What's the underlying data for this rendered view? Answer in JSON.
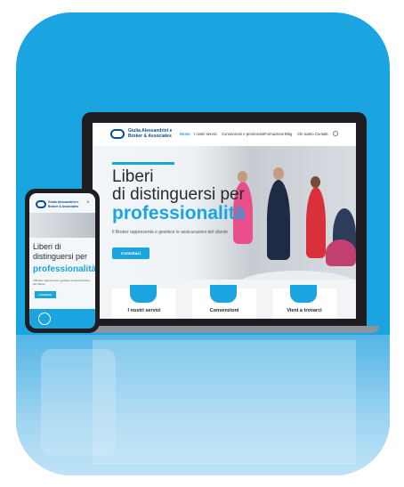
{
  "desktop": {
    "logo_text": "Giulia Alessandrini e Broker & Associates",
    "nav": [
      "Home",
      "I nostri servizi",
      "Convenzioni e promozioni",
      "Formazione",
      "Blog",
      "Chi siamo",
      "Contatti"
    ],
    "hero": {
      "line1": "Liberi",
      "line2": "di distinguersi per",
      "line3": "professionalità",
      "subtitle": "Il Broker rappresenta e gestisce le assicurazioni del cliente",
      "button": "Contattaci"
    },
    "services": [
      "I nostri servizi",
      "Convenzioni",
      "Vieni a trovarci"
    ]
  },
  "mobile": {
    "logo_text": "Giulia Alessandrini e Broker & Associates",
    "close_icon": "×",
    "hero": {
      "line1": "Liberi di",
      "line2": "distinguersi per",
      "line3": "professionalità",
      "subtitle": "Il Broker rappresenta e gestisce le assicurazioni del cliente",
      "button": "Contattaci"
    }
  },
  "colors": {
    "accent": "#1aa5e0",
    "brand": "#0a4d8c",
    "background_card": "#1aa5e0"
  }
}
